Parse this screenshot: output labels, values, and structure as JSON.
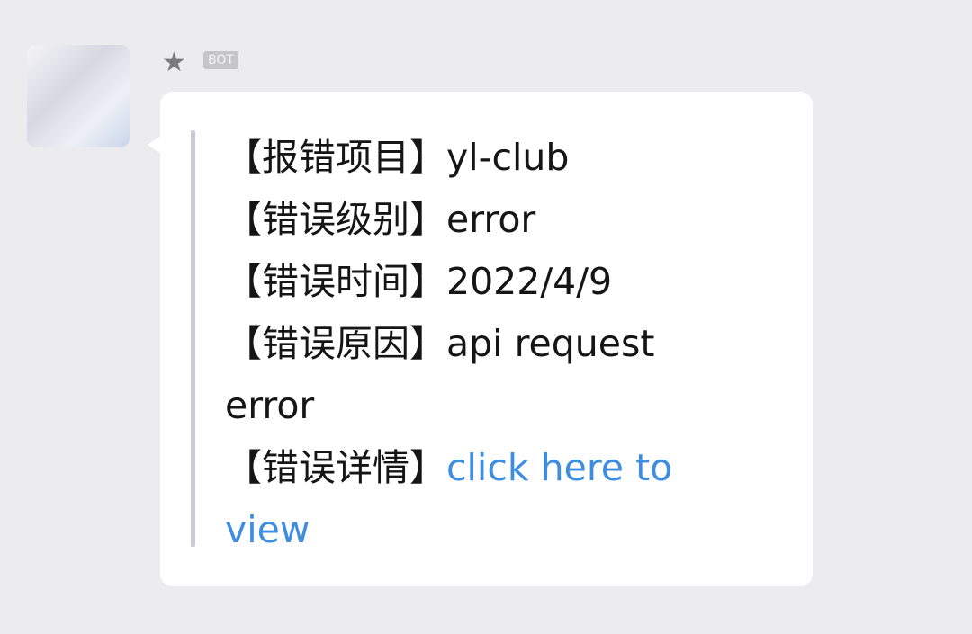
{
  "sender": {
    "badge": "BOT",
    "star_icon": "star-icon"
  },
  "message": {
    "lines": [
      {
        "label": "【报错项目】",
        "value": "yl-club"
      },
      {
        "label": "【错误级别】",
        "value": "error"
      },
      {
        "label": "【错误时间】",
        "value": "2022/4/9"
      },
      {
        "label": "【错误原因】",
        "value": "api request error"
      },
      {
        "label": "【错误详情】",
        "value": "click here to view"
      }
    ],
    "link_color": "#3d8ee0"
  }
}
